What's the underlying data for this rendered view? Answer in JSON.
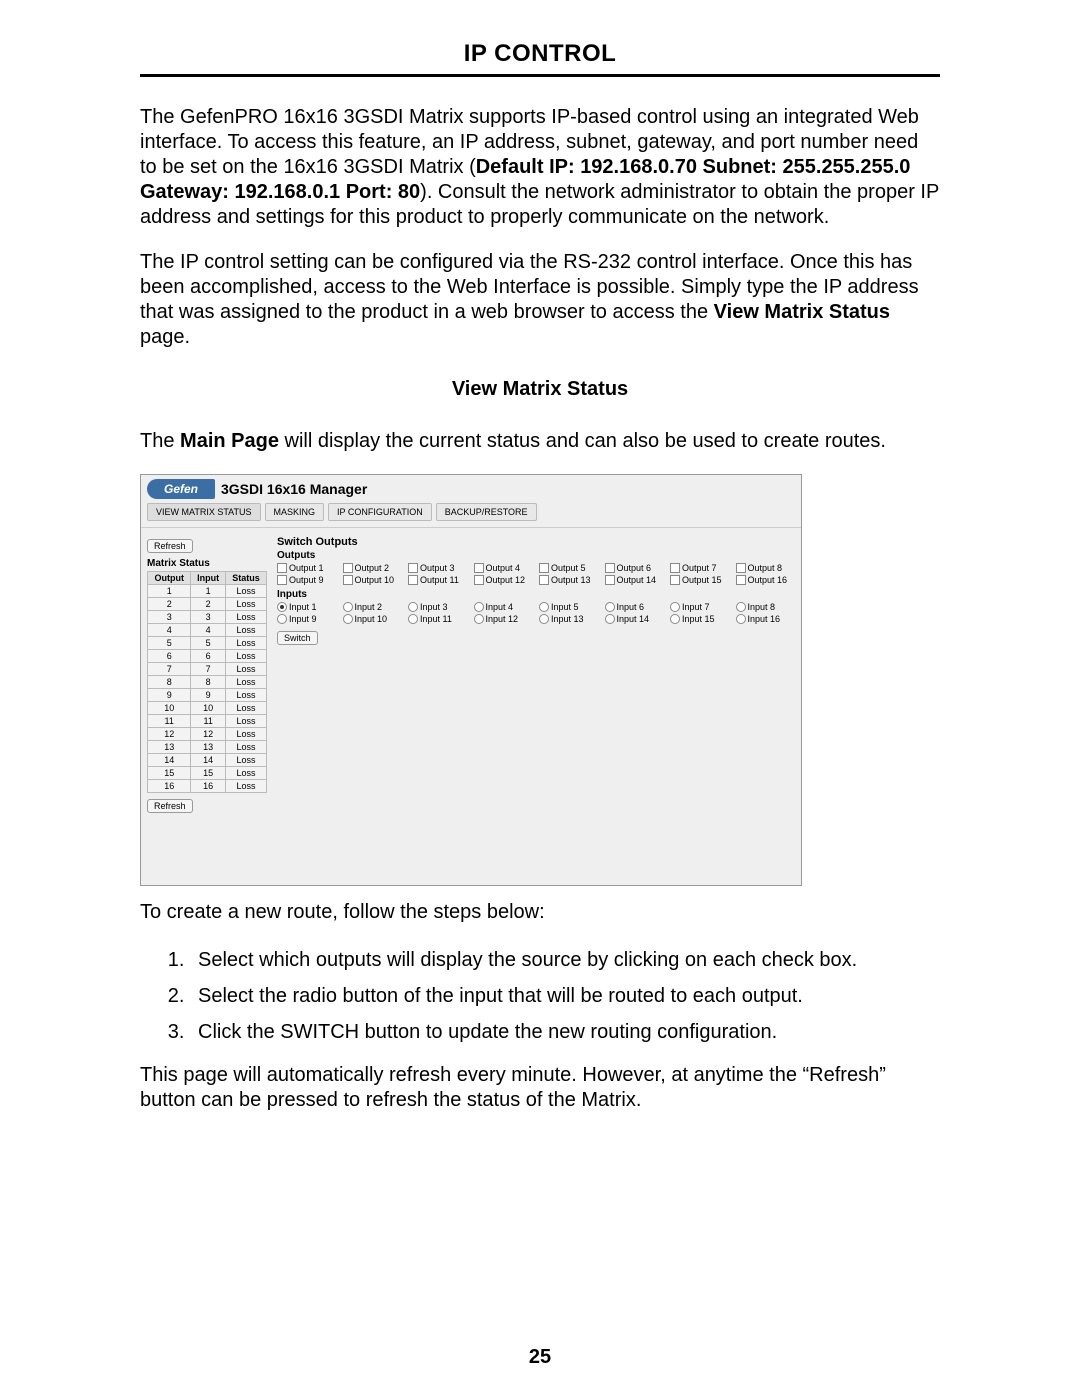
{
  "title": "IP CONTROL",
  "para1_a": "The GefenPRO 16x16 3GSDI Matrix supports IP-based control using an integrated Web interface. To access this feature, an IP address, subnet, gateway, and port number need to be set on the 16x16 3GSDI Matrix (",
  "para1_bold1": "Default IP: 192.168.0.70 Subnet: 255.255.255.0 Gateway: 192.168.0.1 Port: 80",
  "para1_b": "). Consult the network administrator to obtain the proper IP address and settings for this product to properly communicate on the network.",
  "para2_a": "The IP control setting can be configured via the RS-232 control interface. Once this has been accomplished, access to the Web Interface is possible. Simply type the IP address that was assigned to the product in a web browser to access the ",
  "para2_bold": "View Matrix Status",
  "para2_b": " page.",
  "subhead": "View Matrix Status",
  "para3_a": "The ",
  "para3_bold": "Main Page",
  "para3_b": " will display the current status and can also be used to create routes.",
  "screenshot": {
    "logo": "Gefen",
    "title": "3GSDI 16x16 Manager",
    "tabs": {
      "view": "VIEW MATRIX STATUS",
      "mask": "MASKING",
      "ipconf": "IP CONFIGURATION",
      "backup": "BACKUP/RESTORE"
    },
    "refresh": "Refresh",
    "matrix_status_title": "Matrix Status",
    "cols": {
      "output": "Output",
      "input": "Input",
      "status": "Status"
    },
    "rows": [
      {
        "o": "1",
        "i": "1",
        "s": "Loss"
      },
      {
        "o": "2",
        "i": "2",
        "s": "Loss"
      },
      {
        "o": "3",
        "i": "3",
        "s": "Loss"
      },
      {
        "o": "4",
        "i": "4",
        "s": "Loss"
      },
      {
        "o": "5",
        "i": "5",
        "s": "Loss"
      },
      {
        "o": "6",
        "i": "6",
        "s": "Loss"
      },
      {
        "o": "7",
        "i": "7",
        "s": "Loss"
      },
      {
        "o": "8",
        "i": "8",
        "s": "Loss"
      },
      {
        "o": "9",
        "i": "9",
        "s": "Loss"
      },
      {
        "o": "10",
        "i": "10",
        "s": "Loss"
      },
      {
        "o": "11",
        "i": "11",
        "s": "Loss"
      },
      {
        "o": "12",
        "i": "12",
        "s": "Loss"
      },
      {
        "o": "13",
        "i": "13",
        "s": "Loss"
      },
      {
        "o": "14",
        "i": "14",
        "s": "Loss"
      },
      {
        "o": "15",
        "i": "15",
        "s": "Loss"
      },
      {
        "o": "16",
        "i": "16",
        "s": "Loss"
      }
    ],
    "switch_outputs": "Switch Outputs",
    "outputs_label": "Outputs",
    "outputs": [
      "Output 1",
      "Output 2",
      "Output 3",
      "Output 4",
      "Output 5",
      "Output 6",
      "Output 7",
      "Output 8",
      "Output 9",
      "Output 10",
      "Output 11",
      "Output 12",
      "Output 13",
      "Output 14",
      "Output 15",
      "Output 16"
    ],
    "inputs_label": "Inputs",
    "inputs": [
      "Input 1",
      "Input 2",
      "Input 3",
      "Input 4",
      "Input 5",
      "Input 6",
      "Input 7",
      "Input 8",
      "Input 9",
      "Input 10",
      "Input 11",
      "Input 12",
      "Input 13",
      "Input 14",
      "Input 15",
      "Input 16"
    ],
    "switch_btn": "Switch"
  },
  "para4": "To create a new route, follow the steps below:",
  "steps": [
    "Select which outputs will display the source by clicking on each check box.",
    "Select the radio button of the input that will be routed to each output.",
    "Click the SWITCH button to update the new routing configuration."
  ],
  "para5": "This page will automatically refresh every minute.  However, at anytime the “Refresh” button can be pressed to refresh the status of the Matrix.",
  "pagenum": "25"
}
